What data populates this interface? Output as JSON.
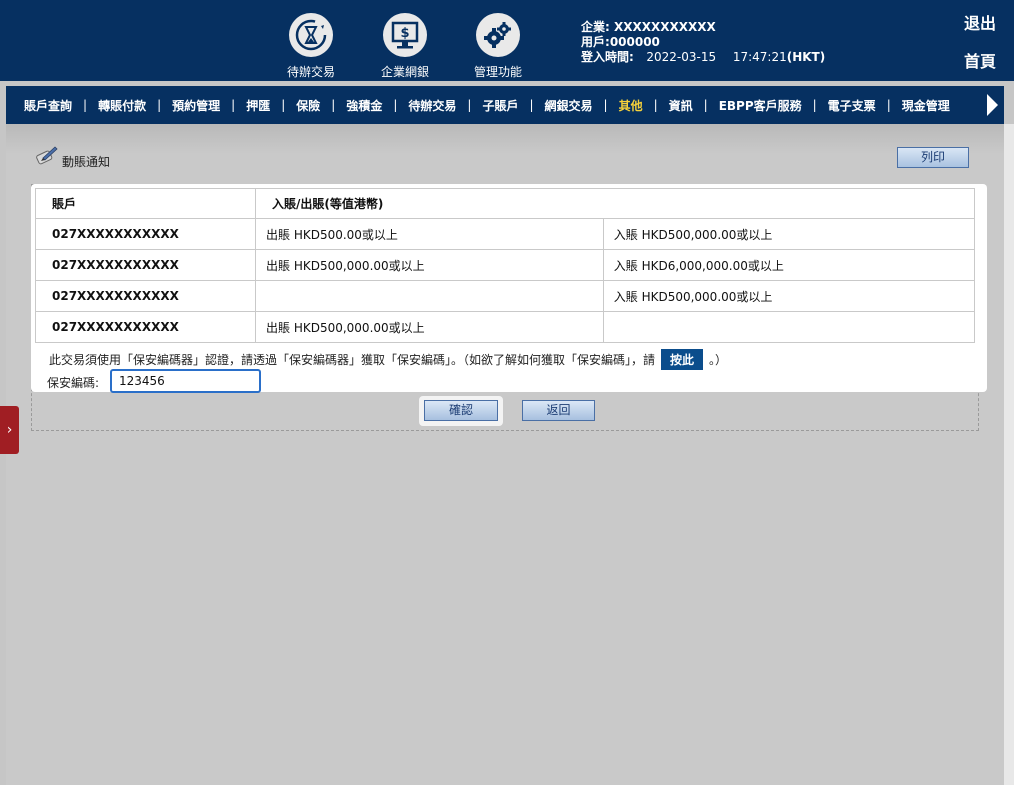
{
  "header": {
    "icons": [
      {
        "label": "待辦交易",
        "icon": "hourglass-refresh-icon"
      },
      {
        "label": "企業網銀",
        "icon": "dollar-monitor-icon"
      },
      {
        "label": "管理功能",
        "icon": "gears-icon"
      }
    ],
    "company_label": "企業:",
    "company_value": "XXXXXXXXXXX",
    "user_label": "用戶:",
    "user_value": "000000",
    "login_label": "登入時間:",
    "login_date": "2022-03-15",
    "login_time": "17:47:21",
    "login_tz": "(HKT)",
    "logout": "退出",
    "home": "首頁"
  },
  "nav": {
    "items": [
      "賬戶查詢",
      "轉賬付款",
      "預約管理",
      "押匯",
      "保險",
      "強積金",
      "待辦交易",
      "子賬戶",
      "網銀交易",
      "其他",
      "資訊",
      "EBPP客戶服務",
      "電子支票",
      "現金管理"
    ],
    "active": "其他"
  },
  "page": {
    "title": "動賬通知",
    "print": "列印"
  },
  "table": {
    "headers": [
      "賬戶",
      "入賬/出賬(等值港幣)"
    ],
    "rows": [
      {
        "account": "027XXXXXXXXXXX",
        "debit": "出賬 HKD500.00或以上",
        "credit": "入賬 HKD500,000.00或以上"
      },
      {
        "account": "027XXXXXXXXXXX",
        "debit": "出賬 HKD500,000.00或以上",
        "credit": "入賬 HKD6,000,000.00或以上"
      },
      {
        "account": "027XXXXXXXXXXX",
        "debit": "",
        "credit": "入賬 HKD500,000.00或以上"
      },
      {
        "account": "027XXXXXXXXXXX",
        "debit": "出賬 HKD500,000.00或以上",
        "credit": ""
      }
    ]
  },
  "security": {
    "note_before": "此交易須使用「保安編碼器」認證，請透過「保安編碼器」獲取「保安編碼」。（如欲了解如何獲取「保安編碼」，請",
    "here": "按此",
    "note_after": "。）",
    "code_label": "保安編碼:",
    "code_value": "123456"
  },
  "actions": {
    "confirm": "確認",
    "back": "返回"
  },
  "colors": {
    "header_bg": "#063061",
    "active_nav": "#f7d23a",
    "side_tab": "#a01e23"
  }
}
